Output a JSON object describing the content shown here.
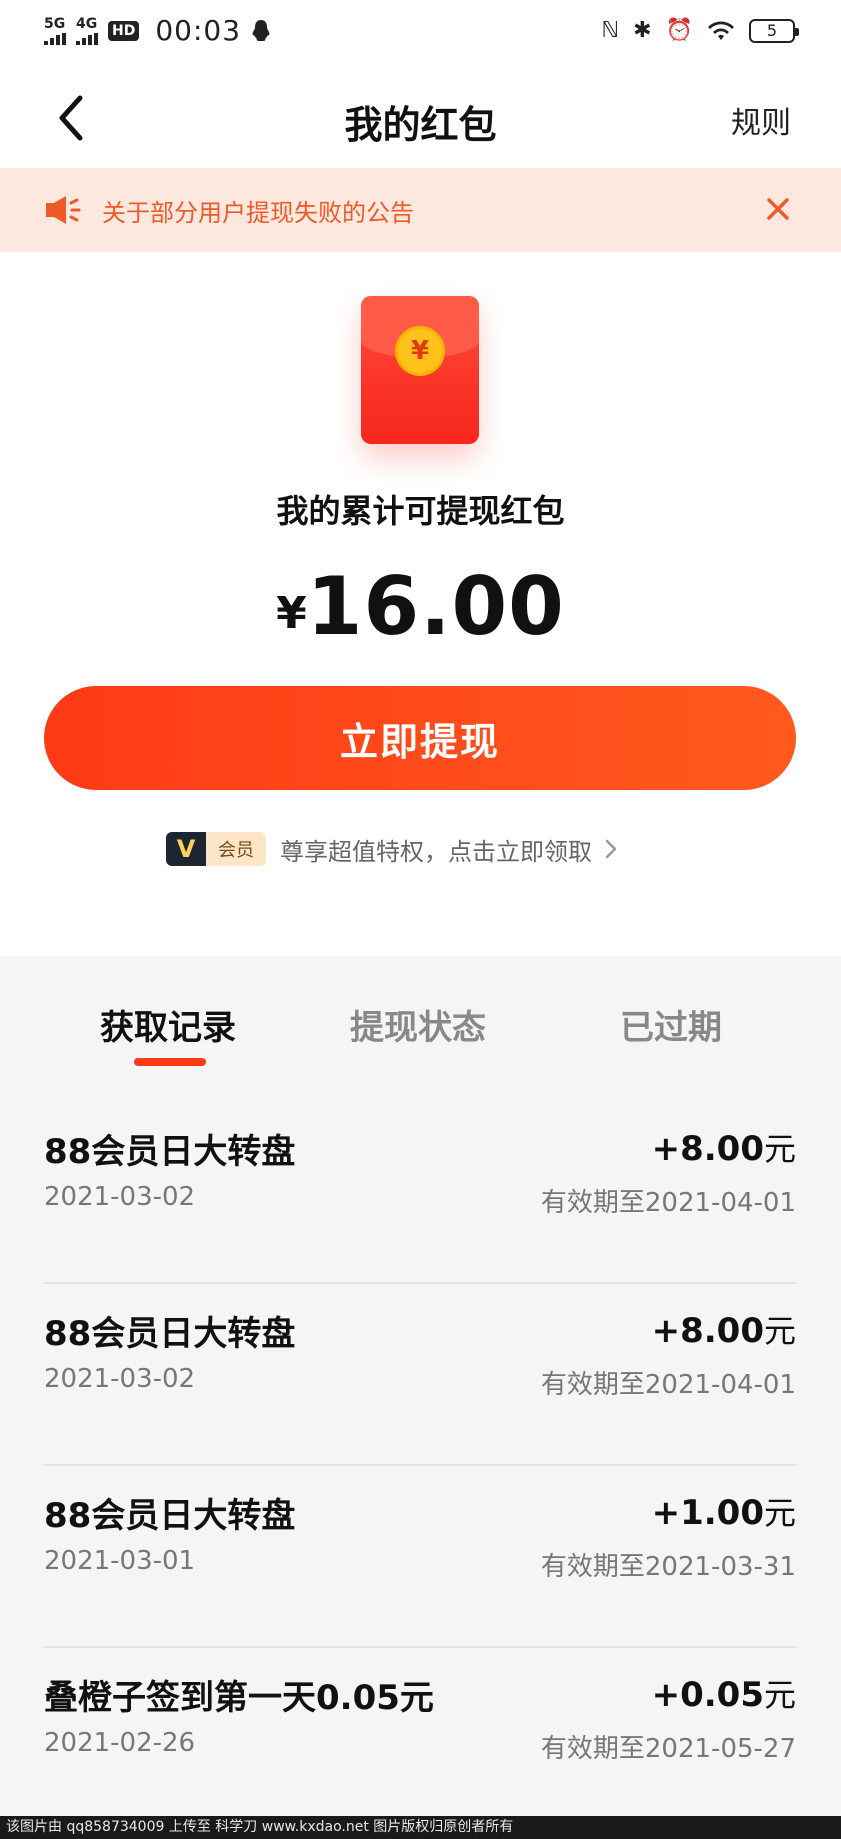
{
  "status_bar": {
    "signal1": "5G",
    "signal2": "4G",
    "hd": "HD",
    "time": "00:03",
    "battery": "5"
  },
  "nav": {
    "title": "我的红包",
    "rules": "规则",
    "back_icon": "chevron-left-icon"
  },
  "notice": {
    "text": "关于部分用户提现失败的公告",
    "icon": "speaker-icon",
    "accent": "#f05a28",
    "background": "#fde8e0"
  },
  "hero": {
    "coin_symbol": "¥",
    "label": "我的累计可提现红包",
    "currency": "¥",
    "amount": "16.00",
    "withdraw_label": "立即提现",
    "brand_color": "#ff3a16"
  },
  "vip": {
    "logo": "V",
    "tag": "会员",
    "text": "尊享超值特权，点击立即领取"
  },
  "tabs": [
    {
      "label": "获取记录",
      "active": true
    },
    {
      "label": "提现状态",
      "active": false
    },
    {
      "label": "已过期",
      "active": false
    }
  ],
  "records": [
    {
      "title": "88会员日大转盘",
      "date": "2021-03-02",
      "amount": "+8.00",
      "unit": "元",
      "expire": "有效期至2021-04-01"
    },
    {
      "title": "88会员日大转盘",
      "date": "2021-03-02",
      "amount": "+8.00",
      "unit": "元",
      "expire": "有效期至2021-04-01"
    },
    {
      "title": "88会员日大转盘",
      "date": "2021-03-01",
      "amount": "+1.00",
      "unit": "元",
      "expire": "有效期至2021-03-31"
    },
    {
      "title": "叠橙子签到第一天0.05元",
      "date": "2021-02-26",
      "amount": "+0.05",
      "unit": "元",
      "expire": "有效期至2021-05-27"
    }
  ],
  "watermark": "该图片由 qq858734009 上传至 科学刀 www.kxdao.net 图片版权归原创者所有"
}
